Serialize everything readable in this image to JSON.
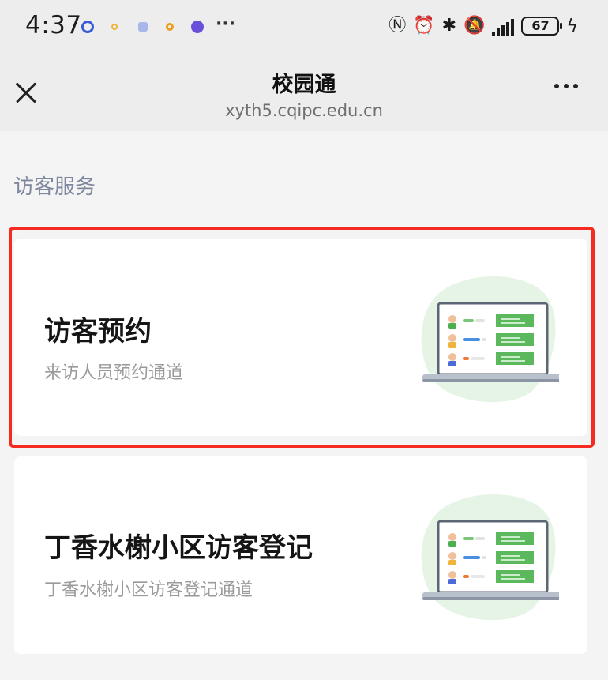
{
  "status_bar": {
    "time": "4:37",
    "battery": "67",
    "app_icon_colors": [
      "#3a5bd9",
      "#f0b43a",
      "#7a8fd8",
      "#e8a020",
      "#6a4fd8"
    ],
    "right_icons": [
      "nfc-icon",
      "alarm-icon",
      "bluetooth-icon",
      "mute-icon",
      "signal-icon",
      "battery-icon",
      "charging-icon"
    ]
  },
  "nav": {
    "title": "校园通",
    "url": "xyth5.cqipc.edu.cn"
  },
  "section": {
    "title": "访客服务"
  },
  "cards": [
    {
      "title": "访客预约",
      "subtitle": "来访人员预约通道",
      "highlighted": true
    },
    {
      "title": "丁香水榭小区访客登记",
      "subtitle": "丁香水榭小区访客登记通道",
      "highlighted": false
    }
  ],
  "colors": {
    "highlight": "#f52b22",
    "illustration_green": "#5cb85c",
    "section_title": "#7f879e"
  }
}
